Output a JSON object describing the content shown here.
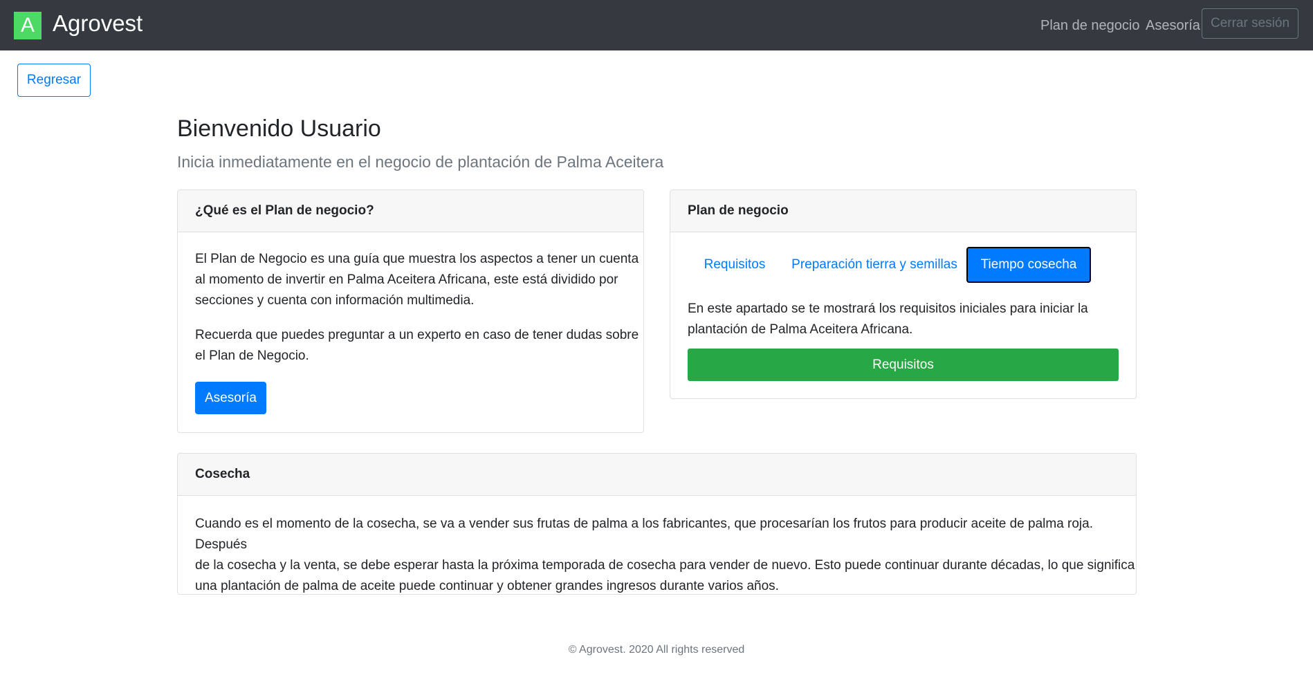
{
  "navbar": {
    "logo_letter": "A",
    "brand": "Agrovest",
    "links": [
      "Plan de negocio",
      "Asesoría"
    ],
    "logout_label": "Cerrar sesión"
  },
  "back_label": "Regresar",
  "header": {
    "title": "Bienvenido Usuario",
    "subtitle": "Inicia inmediatamente en el negocio de plantación de Palma Aceitera"
  },
  "card_what": {
    "header": "¿Qué es el Plan de negocio?",
    "p1_lines": [
      "El Plan de Negocio es una guía que muestra los aspectos a tener un cuenta",
      "al momento de invertir en Palma Aceitera Africana, este está dividido por",
      "secciones y cuenta con información multimedia."
    ],
    "p2_lines": [
      "Recuerda que puedes preguntar a un experto en caso de tener dudas sobre",
      "el Plan de Negocio."
    ],
    "button": "Asesoría"
  },
  "card_plan": {
    "header": "Plan de negocio",
    "tabs": [
      "Requisitos",
      "Preparación tierra y semillas",
      "Tiempo cosecha"
    ],
    "active_tab": "Tiempo cosecha",
    "text_lines": [
      "En este apartado se te mostrará los requisitos iniciales para iniciar la",
      "plantación de Palma Aceitera Africana."
    ],
    "button": "Requisitos"
  },
  "card_harvest": {
    "header": "Cosecha",
    "text_lines": [
      "Cuando es el momento de la cosecha, se va a vender sus frutas de palma a los fabricantes, que procesarían los frutos para producir aceite de palma roja. Después",
      "de la cosecha y la venta, se debe esperar hasta la próxima temporada de cosecha para vender de nuevo. Esto puede continuar durante décadas, lo que significa",
      "una plantación de palma de aceite puede continuar y obtener grandes ingresos durante varios años."
    ]
  },
  "footer": "© Agrovest. 2020 All rights reserved",
  "colors": {
    "navbar": "#343a40",
    "primary": "#007bff",
    "success": "#28a745",
    "logo": "#4cd964"
  }
}
